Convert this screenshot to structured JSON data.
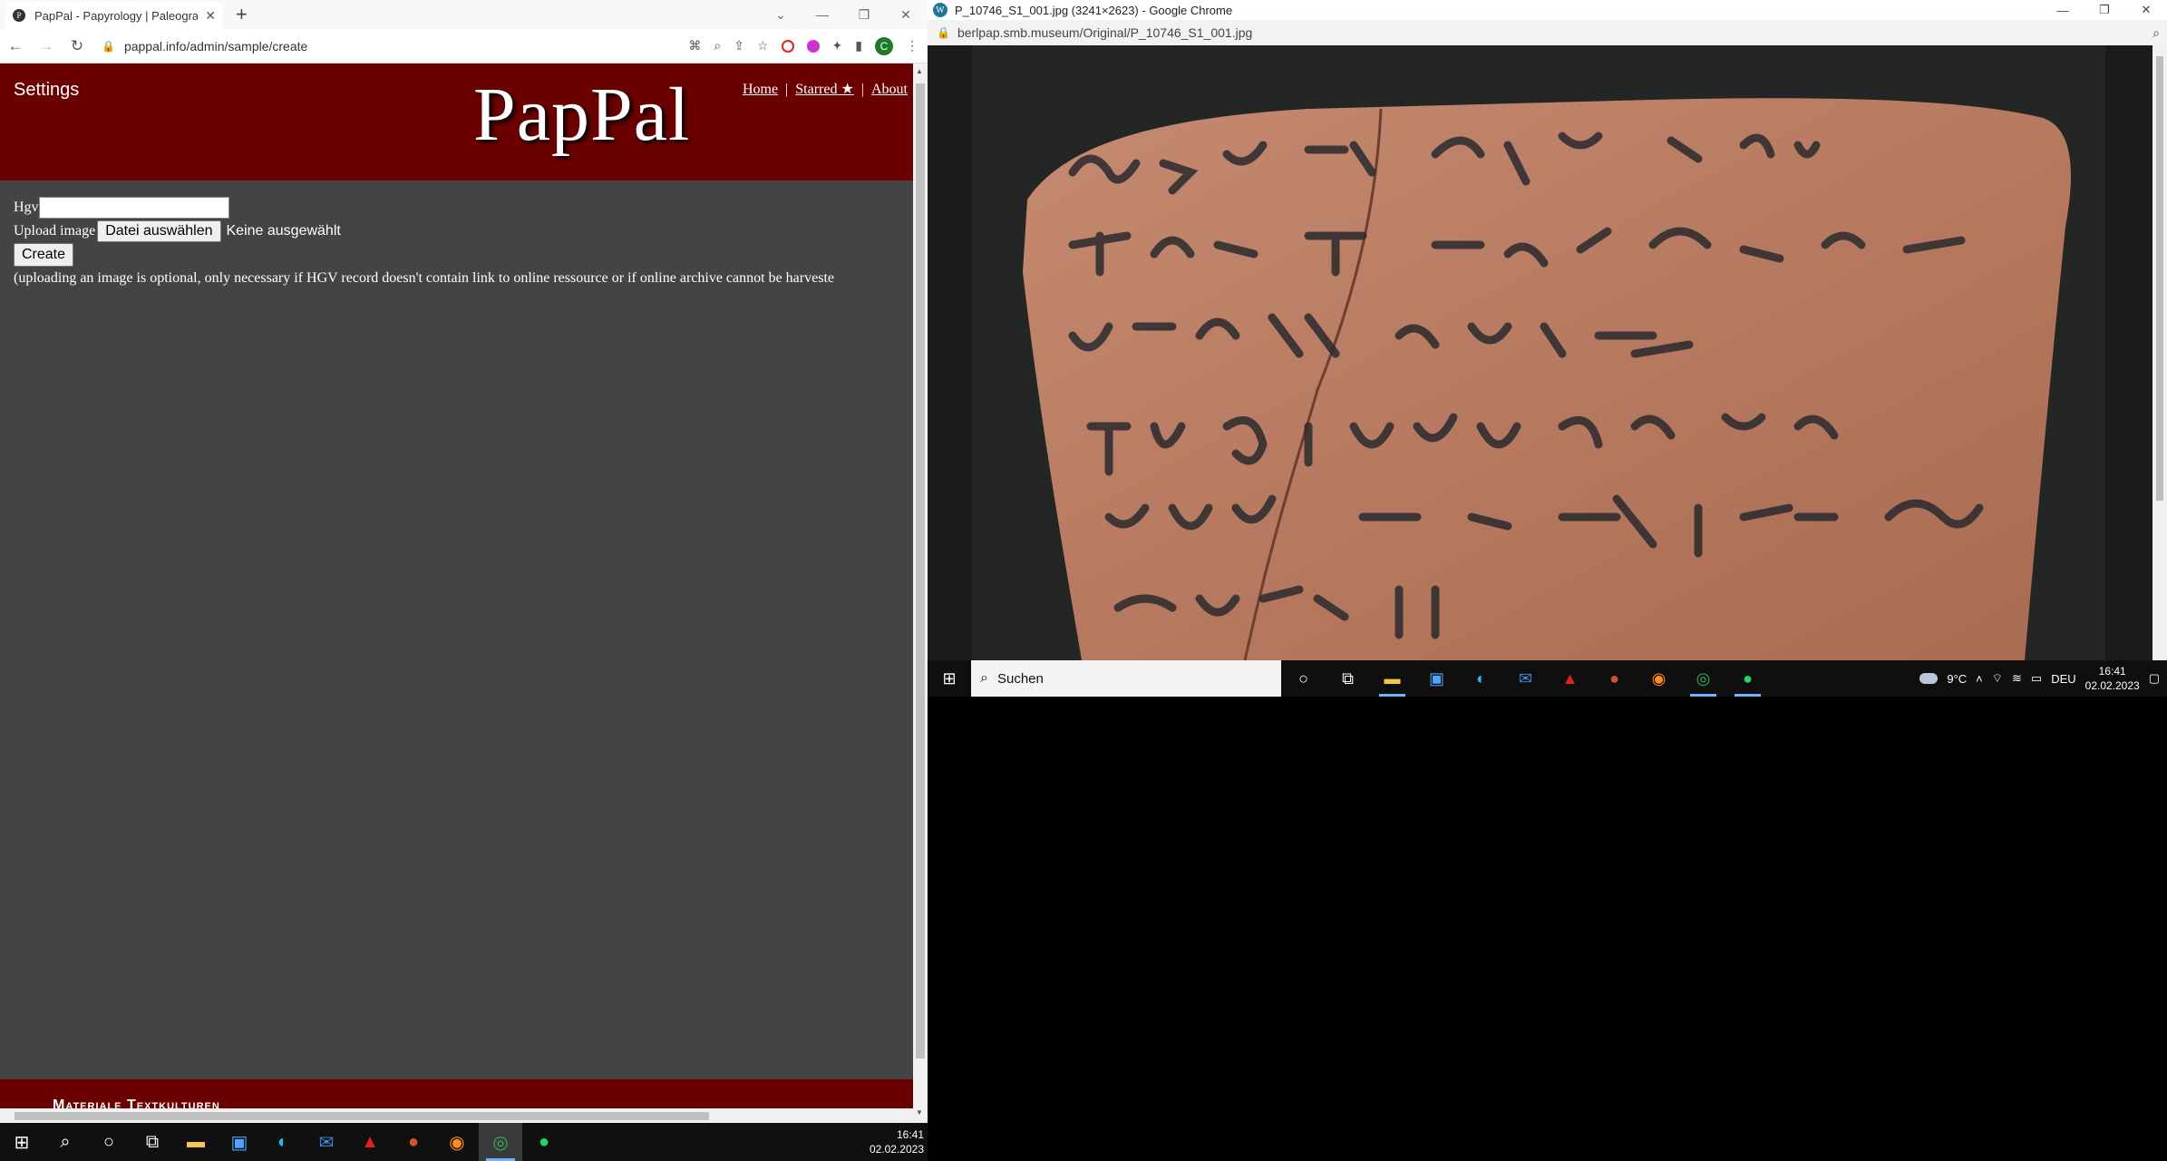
{
  "left_browser": {
    "tab": {
      "title": "PapPal - Papyrology | Paleograph...",
      "favicon": "pappal-icon"
    },
    "url": "pappal.info/admin/sample/create",
    "avatar_letter": "C"
  },
  "site": {
    "settings": "Settings",
    "logo": "PapPal",
    "nav": {
      "home": "Home",
      "starred": "Starred ★",
      "about": "About",
      "sep": "|"
    },
    "form": {
      "hgv_label": "Hgv",
      "hgv_value": "",
      "upload_label": "Upload image",
      "file_button": "Datei auswählen",
      "file_status": "Keine ausgewählt",
      "create_button": "Create",
      "note": "(uploading an image is optional, only necessary if HGV record doesn't contain link to online ressource or if online archive cannot be harveste"
    },
    "footer": "Materiale Textkulturen"
  },
  "left_taskbar": {
    "time": "16:41",
    "date": "02.02.2023"
  },
  "right_browser": {
    "title": "P_10746_S1_001.jpg (3241×2623) - Google Chrome",
    "url": "berlpap.smb.museum/Original/P_10746_S1_001.jpg"
  },
  "right_taskbar": {
    "search": "Suchen",
    "weather": "9°C",
    "lang": "DEU",
    "time": "16:41",
    "date": "02.02.2023"
  }
}
